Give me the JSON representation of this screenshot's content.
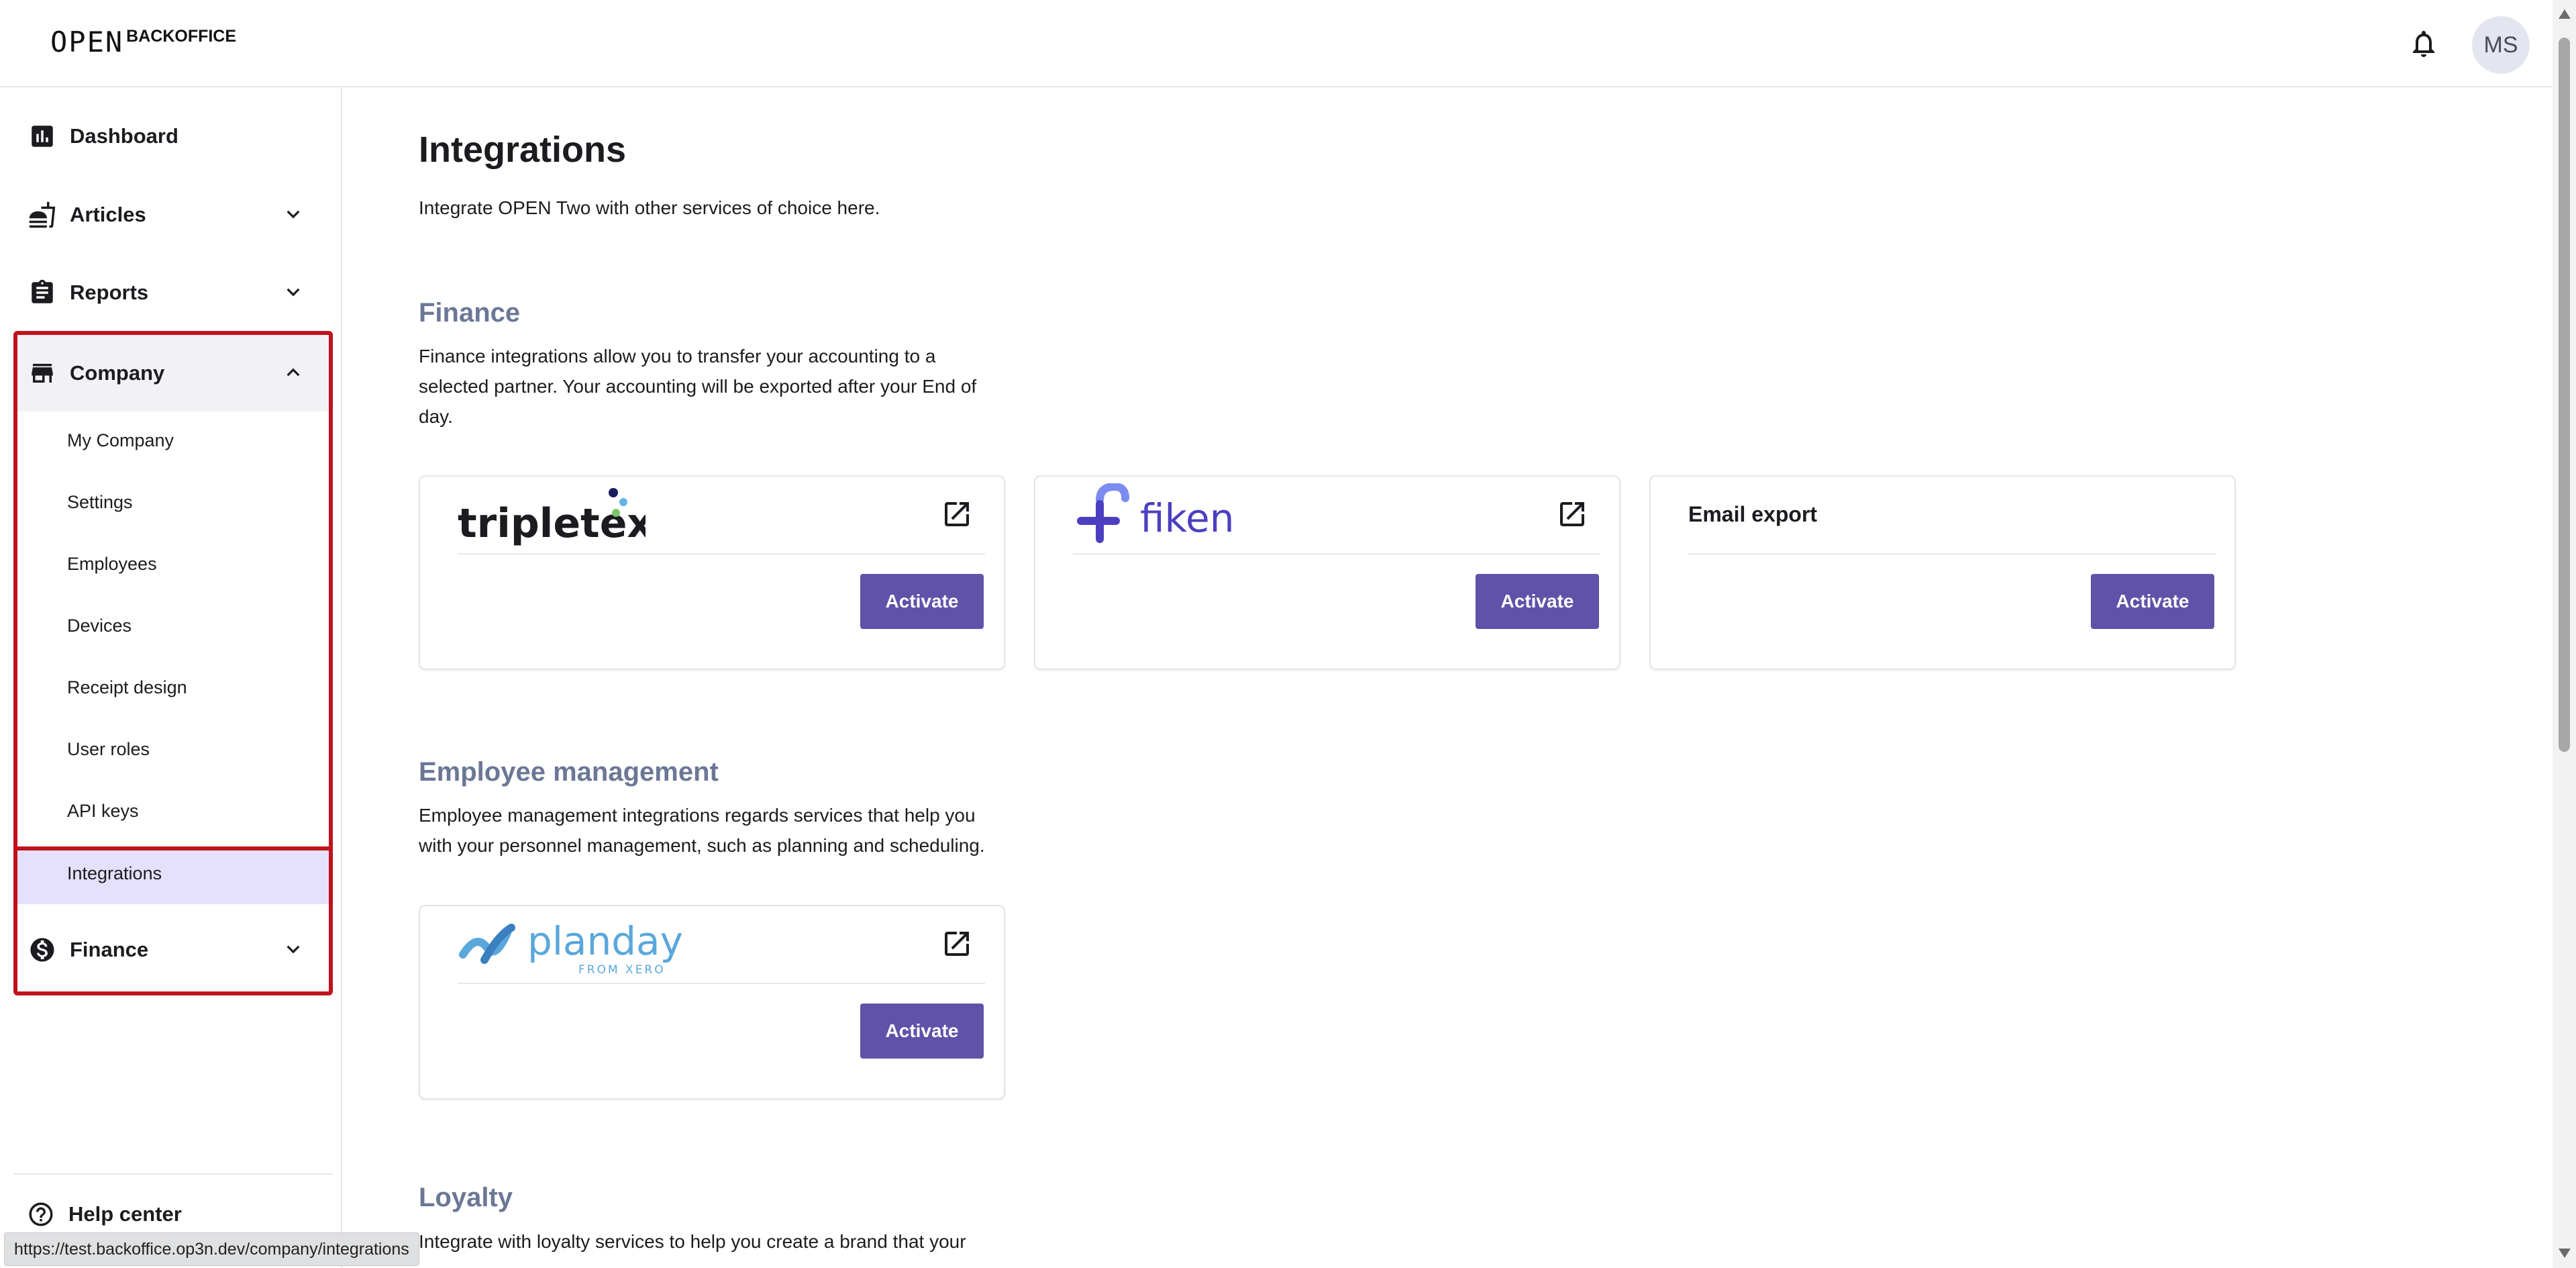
{
  "header": {
    "logo_text": "OPEN",
    "logo_sub": "BACKOFFICE",
    "avatar_initials": "MS"
  },
  "sidebar": {
    "items": [
      {
        "label": "Dashboard",
        "icon": "bar-chart-icon"
      },
      {
        "label": "Articles",
        "icon": "food-icon"
      },
      {
        "label": "Reports",
        "icon": "clipboard-icon"
      },
      {
        "label": "Company",
        "icon": "store-icon"
      },
      {
        "label": "Finance",
        "icon": "dollar-icon"
      }
    ],
    "company_sub": [
      "My Company",
      "Settings",
      "Employees",
      "Devices",
      "Receipt design",
      "User roles",
      "API keys",
      "Integrations"
    ],
    "help_label": "Help center"
  },
  "status_url": "https://test.backoffice.op3n.dev/company/integrations",
  "main": {
    "title": "Integrations",
    "description": "Integrate OPEN Two with other services of choice here.",
    "sections": [
      {
        "title": "Finance",
        "description": "Finance integrations allow you to transfer your accounting to a selected partner. Your accounting will be exported after your End of day.",
        "cards": [
          {
            "name": "tripletex",
            "action": "Activate"
          },
          {
            "name": "fiken",
            "action": "Activate"
          },
          {
            "name": "Email export",
            "action": "Activate"
          }
        ]
      },
      {
        "title": "Employee management",
        "description": "Employee management integrations regards services that help you with your personnel management, such as planning and scheduling.",
        "cards": [
          {
            "name": "planday",
            "tagline": "FROM XERO",
            "action": "Activate"
          }
        ]
      },
      {
        "title": "Loyalty",
        "description": "Integrate with loyalty services to help you create a brand that your"
      }
    ]
  },
  "colors": {
    "primary": "#5f52a8",
    "section_title": "#6b7795",
    "highlight_border": "#c0121d",
    "active_bg": "#e5e0fb"
  }
}
